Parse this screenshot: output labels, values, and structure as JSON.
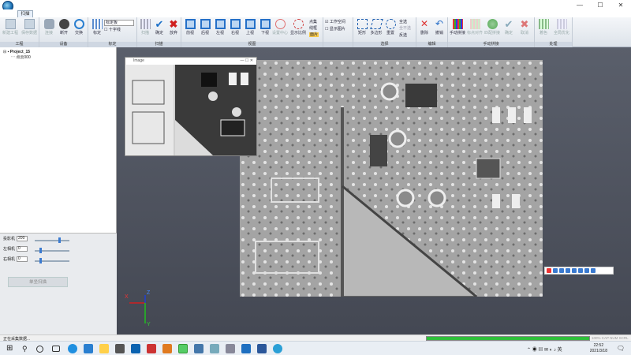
{
  "app": {
    "tab": "扫描",
    "window_buttons": [
      "—",
      "☐",
      "✕"
    ]
  },
  "ribbon": {
    "groups": [
      {
        "label": "工程",
        "buttons": [
          "新建工程",
          "保存数据"
        ]
      },
      {
        "label": "设备",
        "buttons": [
          "连接",
          "断开",
          "交换"
        ]
      },
      {
        "label": "标定",
        "buttons": [
          "标定"
        ],
        "options": [
          "标定板",
          "十字线"
        ]
      },
      {
        "label": "扫描",
        "buttons": [
          "扫描",
          "确定",
          "放弃"
        ]
      },
      {
        "label": "视图",
        "buttons": [
          "前视",
          "后视",
          "左视",
          "右视",
          "上视",
          "下视",
          "设置中心",
          "显示比例"
        ],
        "options": [
          "点集",
          "线框",
          "面片"
        ]
      },
      {
        "label": "视图选项",
        "options": [
          "工作空间",
          "显示图片"
        ]
      },
      {
        "label": "选择",
        "buttons": [
          "矩形",
          "多边形",
          "重置"
        ],
        "options": [
          "全选",
          "全不选",
          "反选"
        ]
      },
      {
        "label": "编辑",
        "buttons": [
          "删除",
          "撤销"
        ]
      },
      {
        "label": "手动拼接",
        "buttons": [
          "手动拼接",
          "标点对齐",
          "匹配拼接",
          "确定",
          "取消"
        ]
      },
      {
        "label": "处理",
        "buttons": [
          "着色",
          "全局优化"
        ]
      }
    ]
  },
  "tree": {
    "project": "Project_15",
    "child": "点云000"
  },
  "controls": {
    "projector_label": "投影机",
    "projector_value": "200",
    "left_cam_label": "左相机",
    "left_cam_value": "0",
    "right_cam_label": "右相机",
    "right_cam_value": "0",
    "start_button": "单坐扫描"
  },
  "image_window": {
    "title": "Image"
  },
  "axis": {
    "x": "X",
    "y": "Y",
    "z": "Z"
  },
  "status": {
    "text": "正在采集数据...",
    "progress": 1.0,
    "indicators": "100% CAP NUM SCRL"
  },
  "taskbar": {
    "time": "22:52",
    "date": "2021/3/18"
  }
}
